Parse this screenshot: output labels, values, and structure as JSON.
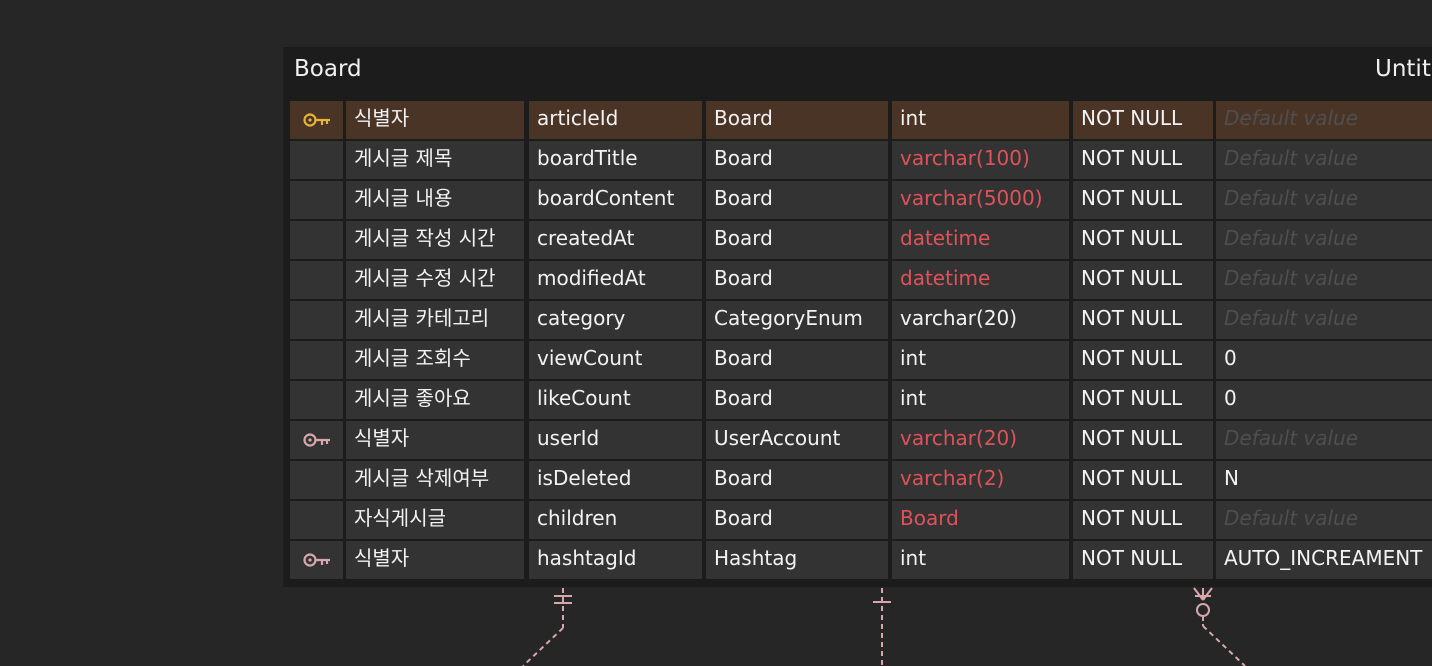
{
  "entity": {
    "name": "Board",
    "comment": "Untitled"
  },
  "rows": [
    {
      "key": "pk",
      "key_icon": "key-icon",
      "logical": "식별자",
      "physical": "articleId",
      "domain": "Board",
      "type": "int",
      "type_highlight": false,
      "null": "NOT NULL",
      "default": "Default value",
      "default_is_placeholder": true,
      "selected": true
    },
    {
      "key": "",
      "key_icon": "",
      "logical": "게시글 제목",
      "physical": "boardTitle",
      "domain": "Board",
      "type": "varchar(100)",
      "type_highlight": true,
      "null": "NOT NULL",
      "default": "Default value",
      "default_is_placeholder": true,
      "selected": false
    },
    {
      "key": "",
      "key_icon": "",
      "logical": "게시글 내용",
      "physical": "boardContent",
      "domain": "Board",
      "type": "varchar(5000)",
      "type_highlight": true,
      "null": "NOT NULL",
      "default": "Default value",
      "default_is_placeholder": true,
      "selected": false
    },
    {
      "key": "",
      "key_icon": "",
      "logical": "게시글 작성 시간",
      "physical": "createdAt",
      "domain": "Board",
      "type": "datetime",
      "type_highlight": true,
      "null": "NOT NULL",
      "default": "Default value",
      "default_is_placeholder": true,
      "selected": false
    },
    {
      "key": "",
      "key_icon": "",
      "logical": "게시글 수정 시간",
      "physical": "modifiedAt",
      "domain": "Board",
      "type": "datetime",
      "type_highlight": true,
      "null": "NOT NULL",
      "default": "Default value",
      "default_is_placeholder": true,
      "selected": false
    },
    {
      "key": "",
      "key_icon": "",
      "logical": "게시글 카테고리",
      "physical": "category",
      "domain": "CategoryEnum",
      "type": "varchar(20)",
      "type_highlight": false,
      "null": "NOT NULL",
      "default": "Default value",
      "default_is_placeholder": true,
      "selected": false
    },
    {
      "key": "",
      "key_icon": "",
      "logical": "게시글 조회수",
      "physical": "viewCount",
      "domain": "Board",
      "type": "int",
      "type_highlight": false,
      "null": "NOT NULL",
      "default": "0",
      "default_is_placeholder": false,
      "selected": false
    },
    {
      "key": "",
      "key_icon": "",
      "logical": "게시글 좋아요",
      "physical": "likeCount",
      "domain": "Board",
      "type": "int",
      "type_highlight": false,
      "null": "NOT NULL",
      "default": "0",
      "default_is_placeholder": false,
      "selected": false
    },
    {
      "key": "fk",
      "key_icon": "key-icon",
      "logical": "식별자",
      "physical": "userId",
      "domain": "UserAccount",
      "type": "varchar(20)",
      "type_highlight": true,
      "null": "NOT NULL",
      "default": "Default value",
      "default_is_placeholder": true,
      "selected": false
    },
    {
      "key": "",
      "key_icon": "",
      "logical": "게시글 삭제여부",
      "physical": "isDeleted",
      "domain": "Board",
      "type": "varchar(2)",
      "type_highlight": true,
      "null": "NOT NULL",
      "default": "N",
      "default_is_placeholder": false,
      "selected": false
    },
    {
      "key": "",
      "key_icon": "",
      "logical": "자식게시글",
      "physical": "children",
      "domain": "Board",
      "type": "Board",
      "type_highlight": true,
      "null": "NOT NULL",
      "default": "Default value",
      "default_is_placeholder": true,
      "selected": false
    },
    {
      "key": "fk",
      "key_icon": "key-icon",
      "logical": "식별자",
      "physical": "hashtagId",
      "domain": "Hashtag",
      "type": "int",
      "type_highlight": false,
      "null": "NOT NULL",
      "default": "AUTO_INCREAMENT",
      "default_is_placeholder": false,
      "selected": false
    }
  ],
  "colors": {
    "background": "#262626",
    "entity_background": "#1c1c1c",
    "cell_background": "#333333",
    "selected_row": "#4a3426",
    "changed_type": "#e0525a",
    "pk_key": "#e3b53a",
    "fk_key": "#d7a7ad",
    "relationship_line": "#d7a7ad"
  },
  "relationships": [
    {
      "name": "relationship-one-and-only-one",
      "notation": "one-and-only-one"
    },
    {
      "name": "relationship-one",
      "notation": "one"
    },
    {
      "name": "relationship-zero-or-many",
      "notation": "zero-or-many"
    }
  ]
}
